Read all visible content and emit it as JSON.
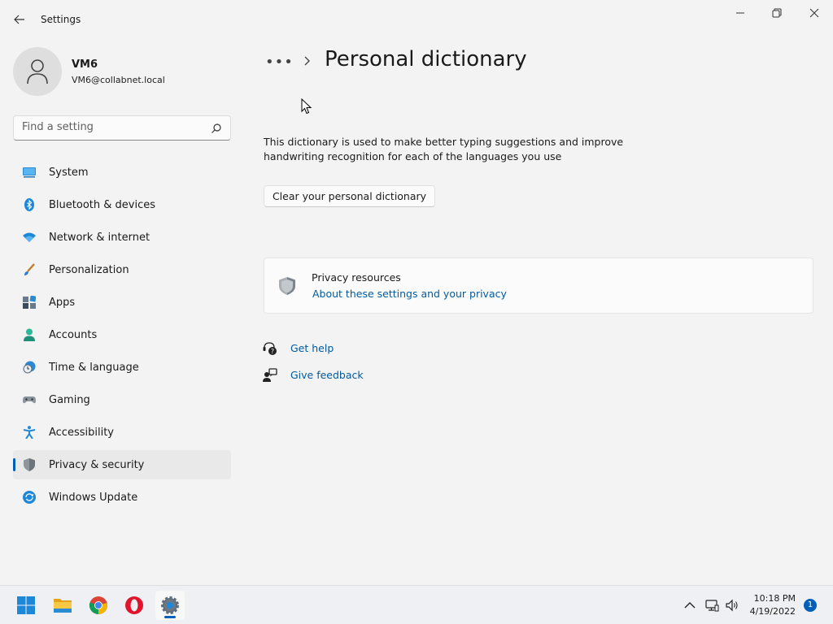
{
  "window": {
    "app_title": "Settings"
  },
  "profile": {
    "name": "VM6",
    "email": "VM6@collabnet.local"
  },
  "search": {
    "placeholder": "Find a setting"
  },
  "sidebar": {
    "items": [
      {
        "label": "System",
        "icon": "system-icon"
      },
      {
        "label": "Bluetooth & devices",
        "icon": "bluetooth-icon"
      },
      {
        "label": "Network & internet",
        "icon": "wifi-icon"
      },
      {
        "label": "Personalization",
        "icon": "brush-icon"
      },
      {
        "label": "Apps",
        "icon": "apps-icon"
      },
      {
        "label": "Accounts",
        "icon": "accounts-icon"
      },
      {
        "label": "Time & language",
        "icon": "clock-globe-icon"
      },
      {
        "label": "Gaming",
        "icon": "gamepad-icon"
      },
      {
        "label": "Accessibility",
        "icon": "accessibility-icon"
      },
      {
        "label": "Privacy & security",
        "icon": "shield-icon",
        "active": true
      },
      {
        "label": "Windows Update",
        "icon": "update-icon"
      }
    ]
  },
  "breadcrumb": {
    "overflow": "•••",
    "title": "Personal dictionary"
  },
  "main": {
    "description": "This dictionary is used to make better typing suggestions and improve handwriting recognition for each of the languages you use",
    "clear_button": "Clear your personal dictionary",
    "privacy_card": {
      "title": "Privacy resources",
      "link": "About these settings and your privacy"
    },
    "help_links": {
      "get_help": "Get help",
      "give_feedback": "Give feedback"
    }
  },
  "taskbar": {
    "apps": [
      "start-icon",
      "file-explorer-icon",
      "chrome-icon",
      "opera-icon",
      "settings-icon"
    ],
    "time": "10:18 PM",
    "date": "4/19/2022",
    "notification_count": "1"
  },
  "colors": {
    "accent": "#005fb8",
    "link": "#005a9e",
    "background": "#f3f3f3"
  }
}
